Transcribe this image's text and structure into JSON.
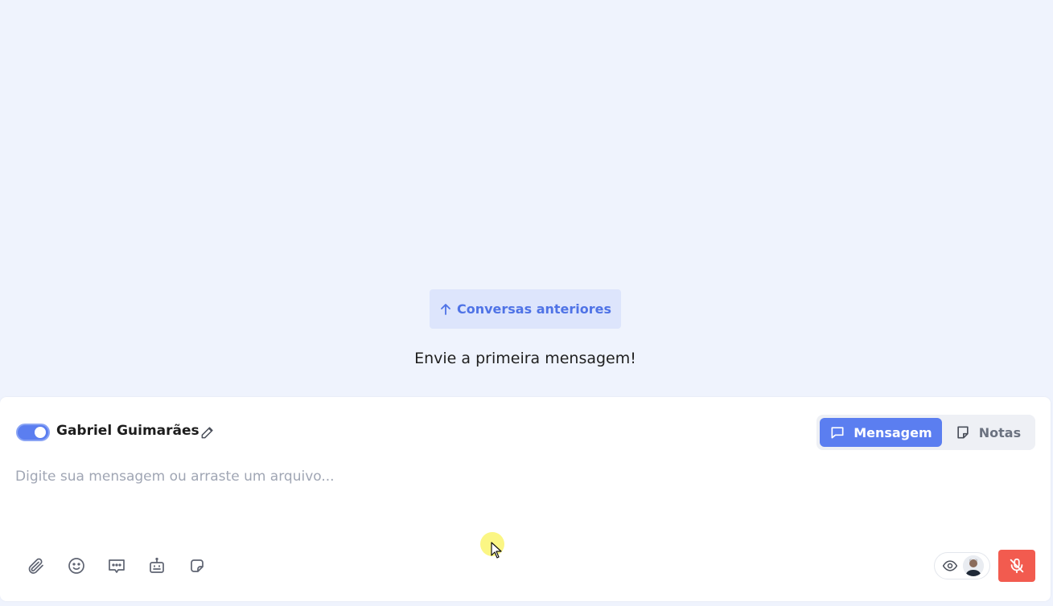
{
  "chat": {
    "previous_conversations_label": "Conversas anteriores",
    "empty_message": "Envie a primeira mensagem!"
  },
  "composer": {
    "agent_name": "Gabriel Guimarães",
    "signature_toggle_on": true,
    "modes": {
      "message_label": "Mensagem",
      "notes_label": "Notas",
      "active": "Mensagem"
    },
    "input_placeholder": "Digite sua mensagem ou arraste um arquivo...",
    "tools": [
      "paperclip-icon",
      "emoji-icon",
      "quick-reply-icon",
      "bot-icon",
      "sticker-icon"
    ],
    "viewers_icon": "eye-icon",
    "mic_icon": "mic-off-icon"
  },
  "colors": {
    "accent": "#5b7ef0",
    "background": "#eff3fd",
    "danger": "#f25b4f"
  }
}
